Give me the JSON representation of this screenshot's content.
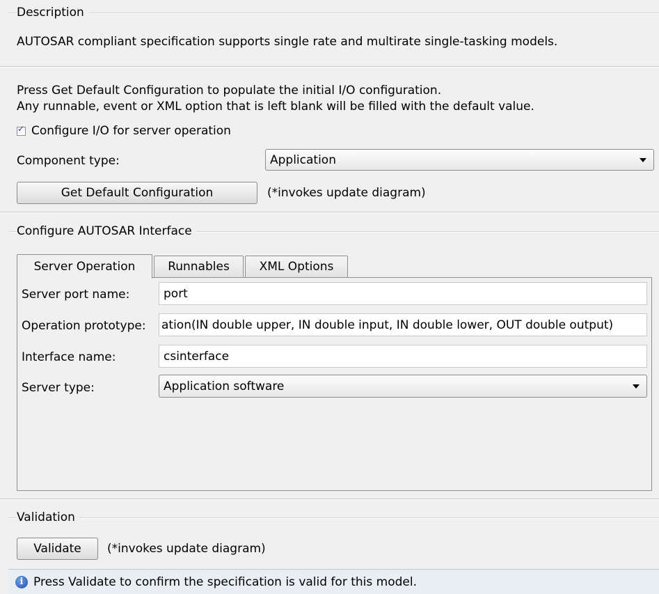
{
  "description": {
    "title": "Description",
    "text": "AUTOSAR compliant specification supports single rate and multirate single-tasking models."
  },
  "config": {
    "instructions_line1": "Press Get Default Configuration to populate the initial I/O configuration.",
    "instructions_line2": "Any runnable, event or XML option that is left blank will be filled with the default value.",
    "server_checkbox_label": "Configure I/O for server operation",
    "server_checkbox_checked": true,
    "component_type_label": "Component type:",
    "component_type_value": "Application",
    "default_button_label": "Get Default Configuration",
    "default_button_note": "(*invokes update diagram)"
  },
  "interface": {
    "title": "Configure AUTOSAR Interface",
    "tabs": [
      {
        "label": "Server Operation",
        "active": true
      },
      {
        "label": "Runnables",
        "active": false
      },
      {
        "label": "XML Options",
        "active": false
      }
    ],
    "fields": {
      "server_port_label": "Server port name:",
      "server_port_value": "port",
      "operation_prototype_label": "Operation prototype:",
      "operation_prototype_value": "ation(IN double upper, IN double input, IN double lower, OUT double output)",
      "interface_name_label": "Interface name:",
      "interface_name_value": "csinterface",
      "server_type_label": "Server type:",
      "server_type_value": "Application software"
    }
  },
  "validation": {
    "title": "Validation",
    "button_label": "Validate",
    "note": "(*invokes update diagram)",
    "info_text": "Press Validate to confirm the specification is valid for this model."
  }
}
